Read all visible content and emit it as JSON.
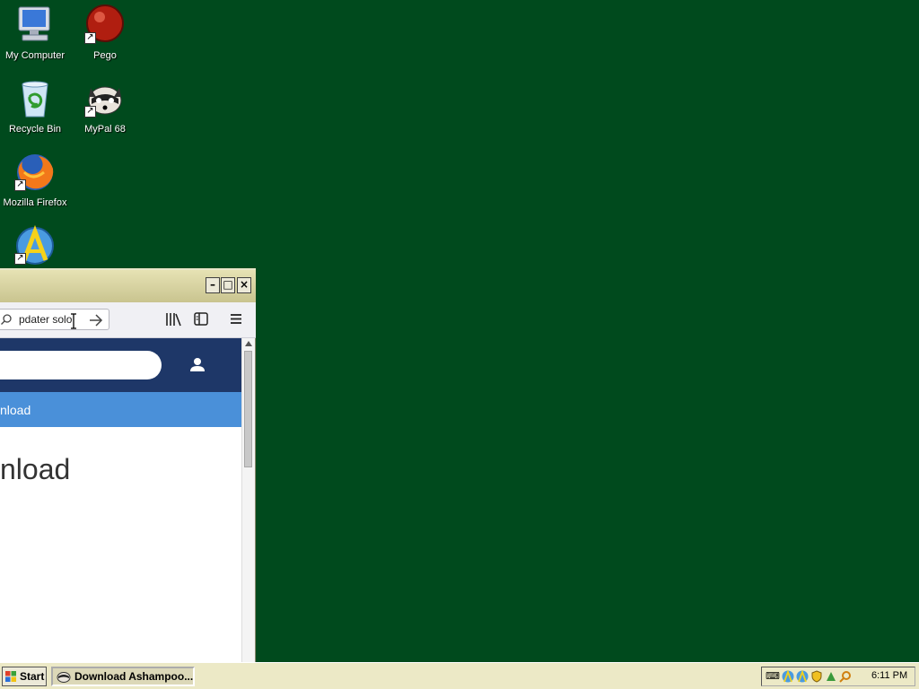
{
  "desktop": {
    "icons": [
      {
        "label": "My Computer",
        "icon": "computer-icon"
      },
      {
        "label": "Pego",
        "icon": "pego-icon"
      },
      {
        "label": "Recycle Bin",
        "icon": "recycle-bin-icon"
      },
      {
        "label": "MyPal 68",
        "icon": "mypal-icon"
      },
      {
        "label": "Mozilla Firefox",
        "icon": "firefox-icon"
      },
      {
        "label": "",
        "icon": "ashampoo-icon"
      }
    ]
  },
  "browser": {
    "titlebar": {
      "minimize": "–",
      "maximize": "□",
      "close": "×"
    },
    "address_bar": {
      "value": "pdater solo",
      "go_icon": "arrow-right-icon",
      "search_icon": "magnifier-icon"
    },
    "toolbar": {
      "library_icon": "library-icon",
      "sidebar_icon": "sidebar-icon",
      "menu_icon": "hamburger-menu-icon"
    },
    "page": {
      "nav_text": "nload",
      "heading": "nload",
      "account_icon": "user-icon"
    }
  },
  "taskbar": {
    "start_label": "Start",
    "task_label": "Download Ashampoo...",
    "clock": "6:11 PM"
  },
  "colors": {
    "desktop": "#004A1D",
    "site_header": "#1E3768",
    "site_nav": "#4A90D9",
    "taskbar": "#ECE9C6"
  }
}
